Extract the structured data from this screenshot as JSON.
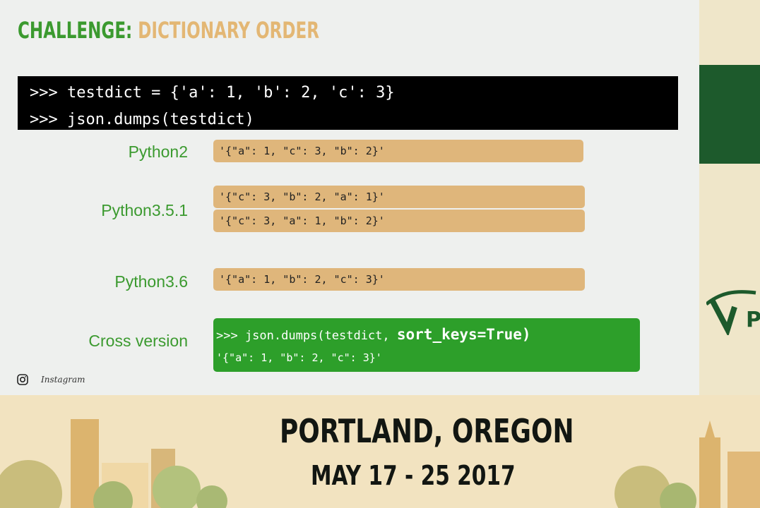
{
  "slide": {
    "title_prefix": "CHALLENGE:",
    "title_main": "DICTIONARY ORDER",
    "code_lines": [
      ">>> testdict = {'a': 1, 'b': 2, 'c': 3}",
      ">>> json.dumps(testdict)"
    ],
    "versions": [
      {
        "label": "Python2",
        "outputs": [
          "'{\"a\": 1, \"c\": 3, \"b\": 2}'"
        ]
      },
      {
        "label": "Python3.5.1",
        "outputs": [
          "'{\"c\": 3, \"b\": 2, \"a\": 1}'",
          "'{\"c\": 3, \"a\": 1, \"b\": 2}'"
        ]
      },
      {
        "label": "Python3.6",
        "outputs": [
          "'{\"a\": 1, \"b\": 2, \"c\": 3}'"
        ]
      }
    ],
    "cross_version": {
      "label": "Cross version",
      "code_prefix": ">>> json.dumps(testdict, ",
      "code_bold": "sort_keys=True",
      "code_suffix": ")",
      "output": "'{\"a\": 1, \"b\": 2, \"c\": 3}'"
    },
    "brand": {
      "name": "Instagram",
      "icon": "instagram-icon"
    }
  },
  "banner": {
    "city": "PORTLAND, OREGON",
    "dates": "MAY 17 - 25 2017"
  },
  "colors": {
    "accent_green": "#3b9a2f",
    "title_tan": "#e3b774",
    "pill_tan": "#dfb67b",
    "cross_green": "#2d9f2a"
  }
}
